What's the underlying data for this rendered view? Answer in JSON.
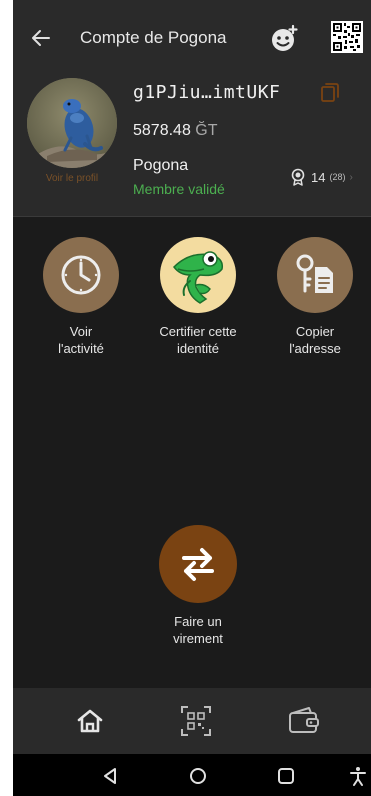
{
  "header": {
    "title": "Compte de Pogona"
  },
  "profile": {
    "address": "g1PJiu…imtUKF",
    "balance": "5878.48",
    "unit": "ĞT",
    "name": "Pogona",
    "status": "Membre validé",
    "view_profile": "Voir le profil",
    "cert_count": "14",
    "cert_pending": "(28)"
  },
  "actions": {
    "activity": "Voir\nl'activité",
    "certify": "Certifier cette\nidentité",
    "copy": "Copier\nl'adresse",
    "transfer": "Faire un\nvirement"
  },
  "icons": {
    "back": "arrow-left-icon",
    "contact": "contact-add-icon",
    "qr": "qr-code-icon",
    "copy": "copy-icon",
    "cert": "award-icon",
    "clock": "clock-icon",
    "cert_identity": "chameleon-icon",
    "copy_address": "key-document-icon",
    "transfer": "transfer-arrows-icon",
    "home": "home-icon",
    "scan": "scan-qr-icon",
    "wallet": "wallet-icon"
  },
  "colors": {
    "accent": "#7a4312",
    "action_bg": "#8a6e4f",
    "valid_green": "#4caf50",
    "surface": "#2a2a2a",
    "background": "#1b1b1b"
  }
}
